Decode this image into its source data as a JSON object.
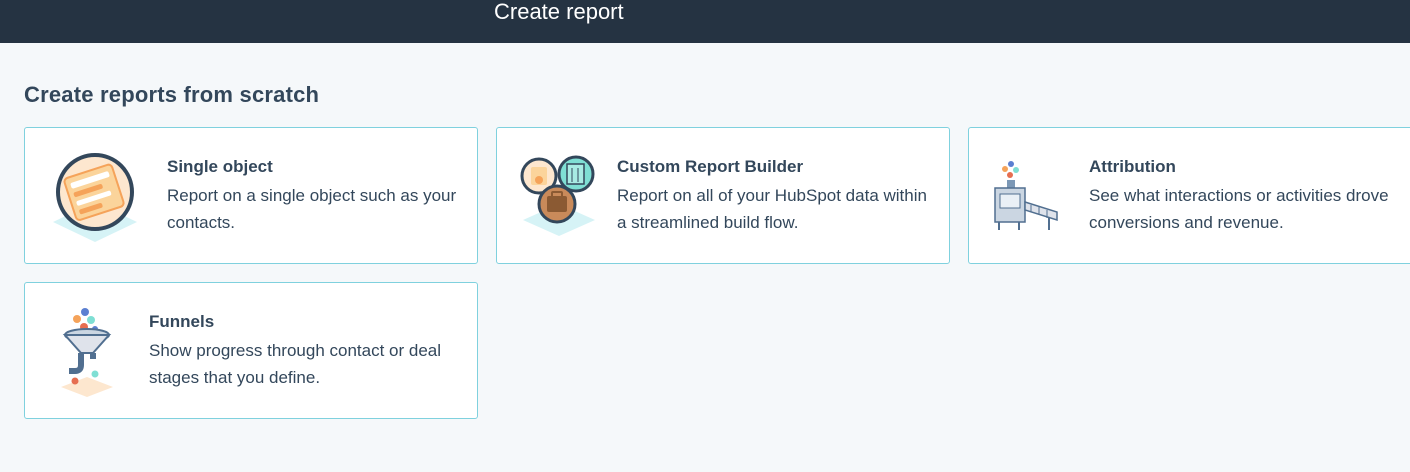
{
  "header": {
    "title": "Create report"
  },
  "section": {
    "title": "Create reports from scratch"
  },
  "cards": [
    {
      "title": "Single object",
      "description": "Report on a single object such as your contacts.",
      "icon": "single-object-icon"
    },
    {
      "title": "Custom Report Builder",
      "description": "Report on all of your HubSpot data within a streamlined build flow.",
      "icon": "custom-report-builder-icon"
    },
    {
      "title": "Attribution",
      "description": "See what interactions or activities drove conversions and revenue.",
      "icon": "attribution-icon"
    },
    {
      "title": "Funnels",
      "description": "Show progress through contact or deal stages that you define.",
      "icon": "funnels-icon"
    }
  ],
  "colors": {
    "header_bg": "#253342",
    "page_bg": "#f5f8fa",
    "card_border": "#7fd1de",
    "text": "#33475b"
  }
}
